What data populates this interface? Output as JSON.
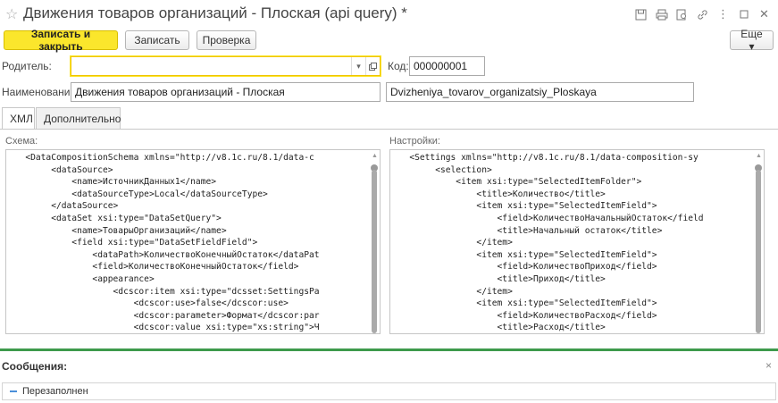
{
  "window": {
    "title": "Движения товаров организаций - Плоская (api query) *"
  },
  "title_icons": [
    "save-icon",
    "print-icon",
    "preview-icon",
    "link-icon",
    "more-icon",
    "maximize-icon",
    "close-icon"
  ],
  "toolbar": {
    "save_close_label": "Записать и закрыть",
    "save_label": "Записать",
    "check_label": "Проверка",
    "more_label": "Еще ▾"
  },
  "form": {
    "parent_label": "Родитель:",
    "parent_value": "",
    "code_label": "Код:",
    "code_value": "000000001",
    "name_label": "Наименование:",
    "name_value": "Движения товаров организаций - Плоская",
    "name_translit_value": "Dvizheniya_tovarov_organizatsiy_Ploskaya"
  },
  "tabs": [
    {
      "label": "ХМЛ",
      "active": true
    },
    {
      "label": "Дополнительно",
      "active": false
    }
  ],
  "schema": {
    "label": "Схема:",
    "code": "   <DataCompositionSchema xmlns=\"http://v8.1c.ru/8.1/data-c\n        <dataSource>\n            <name>ИсточникДанных1</name>\n            <dataSourceType>Local</dataSourceType>\n        </dataSource>\n        <dataSet xsi:type=\"DataSetQuery\">\n            <name>ТоварыОрганизаций</name>\n            <field xsi:type=\"DataSetFieldField\">\n                <dataPath>КоличествоКонечныйОстаток</dataPat\n                <field>КоличествоКонечныйОстаток</field>\n                <appearance>\n                    <dcscor:item xsi:type=\"dcsset:SettingsPa\n                        <dcscor:use>false</dcscor:use>\n                        <dcscor:parameter>Формат</dcscor:par\n                        <dcscor:value xsi:type=\"xs:string\">Ч\n                    </dcscor:item>"
  },
  "settings": {
    "label": "Настройки:",
    "code": "   <Settings xmlns=\"http://v8.1c.ru/8.1/data-composition-sy\n        <selection>\n            <item xsi:type=\"SelectedItemFolder\">\n                <title>Количество</title>\n                <item xsi:type=\"SelectedItemField\">\n                    <field>КоличествоНачальныйОстаток</field\n                    <title>Начальный остаток</title>\n                </item>\n                <item xsi:type=\"SelectedItemField\">\n                    <field>КоличествоПриход</field>\n                    <title>Приход</title>\n                </item>\n                <item xsi:type=\"SelectedItemField\">\n                    <field>КоличествоРасход</field>\n                    <title>Расход</title>\n                </item>"
  },
  "messages": {
    "title": "Сообщения:",
    "close": "×",
    "items": [
      "Перезаполнен"
    ]
  },
  "colors": {
    "accent_yellow": "#fbe62c",
    "separator_green": "#3e9a4c"
  }
}
